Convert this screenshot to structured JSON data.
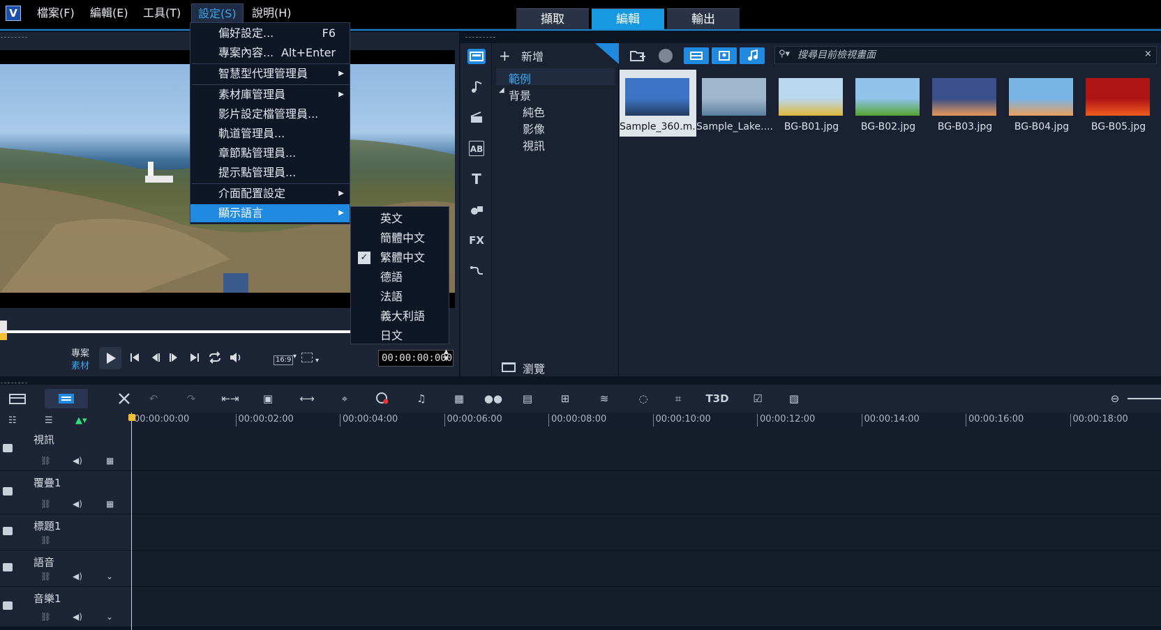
{
  "app": {
    "logo_glyph": "V"
  },
  "menubar": {
    "items": [
      "檔案(F)",
      "編輯(E)",
      "工具(T)",
      "設定(S)",
      "說明(H)"
    ]
  },
  "modes": {
    "tabs": [
      "擷取",
      "編輯",
      "輸出"
    ],
    "selected": "編輯"
  },
  "settings_menu": {
    "items": [
      {
        "label": "偏好設定...",
        "shortcut": "F6"
      },
      {
        "label": "專案內容...",
        "shortcut": "Alt+Enter"
      },
      {
        "label": "智慧型代理管理員"
      },
      {
        "label": "素材庫管理員"
      },
      {
        "label": "影片設定檔管理員..."
      },
      {
        "label": "軌道管理員..."
      },
      {
        "label": "章節點管理員..."
      },
      {
        "label": "提示點管理員..."
      },
      {
        "label": "介面配置設定"
      },
      {
        "label": "顯示語言"
      }
    ]
  },
  "language_menu": {
    "items": [
      "英文",
      "簡體中文",
      "繁體中文",
      "德語",
      "法語",
      "義大利語",
      "日文"
    ],
    "checked": "繁體中文"
  },
  "player": {
    "mode_project": "專案",
    "mode_clip": "素材",
    "aspect": "16:9",
    "timecode": "00:00:00:000"
  },
  "library": {
    "add_label": "新增",
    "search_placeholder": "搜尋目前檢視畫面",
    "browse_label": "瀏覽",
    "tree": {
      "root": "範例",
      "folder": "背景",
      "children": [
        "純色",
        "影像",
        "視訊"
      ]
    },
    "thumbnails": [
      {
        "caption": "Sample_360.m...",
        "colors": [
          "#3d73c4",
          "#233a5e"
        ]
      },
      {
        "caption": "Sample_Lake....",
        "colors": [
          "#9fb7cc",
          "#5b7e9c"
        ]
      },
      {
        "caption": "BG-B01.jpg",
        "colors": [
          "#bcd8ee",
          "#e0b93a"
        ]
      },
      {
        "caption": "BG-B02.jpg",
        "colors": [
          "#8fc3ea",
          "#53a52e"
        ]
      },
      {
        "caption": "BG-B03.jpg",
        "colors": [
          "#3b4f8a",
          "#e69a55"
        ]
      },
      {
        "caption": "BG-B04.jpg",
        "colors": [
          "#7bb5e6",
          "#e8a05a"
        ]
      },
      {
        "caption": "BG-B05.jpg",
        "colors": [
          "#b01515",
          "#f25c1c"
        ]
      }
    ]
  },
  "timeline": {
    "ruler": [
      "00:00:00:00",
      "00:00:02:00",
      "00:00:04:00",
      "00:00:06:00",
      "00:00:08:00",
      "00:00:10:00",
      "00:00:12:00",
      "00:00:14:00",
      "00:00:16:00",
      "00:00:18:00"
    ],
    "tracks": [
      "視訊",
      "覆疊1",
      "標題1",
      "語音",
      "音樂1"
    ]
  },
  "sidebar": {
    "fx_label": "FX",
    "title_label": "T",
    "ab_label": "AB"
  },
  "colors": {
    "accent": "#1f8ae0",
    "menu_bg": "#0f1726",
    "panel": "#1c2435"
  }
}
